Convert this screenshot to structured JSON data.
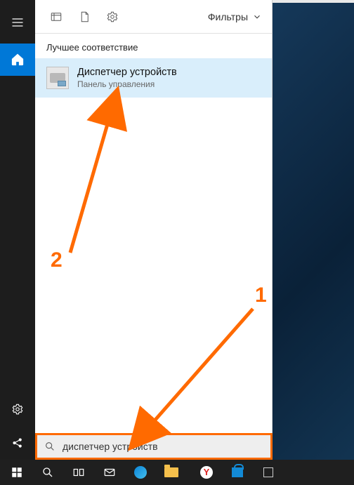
{
  "window": {
    "os": "Windows 10"
  },
  "leftRail": {
    "items": [
      "menu",
      "home"
    ],
    "bottom": [
      "settings",
      "share"
    ]
  },
  "panelTop": {
    "filters_label": "Фильтры"
  },
  "section": {
    "best_match": "Лучшее соответствие"
  },
  "result": {
    "title": "Диспетчер устройств",
    "subtitle": "Панель управления"
  },
  "search": {
    "value": "диспетчер устройств",
    "placeholder": ""
  },
  "annotations": {
    "label1": "1",
    "label2": "2"
  },
  "taskbar": {
    "items": [
      "start",
      "search",
      "taskview",
      "mail",
      "edge",
      "folder",
      "yandex",
      "store",
      "tray"
    ]
  }
}
